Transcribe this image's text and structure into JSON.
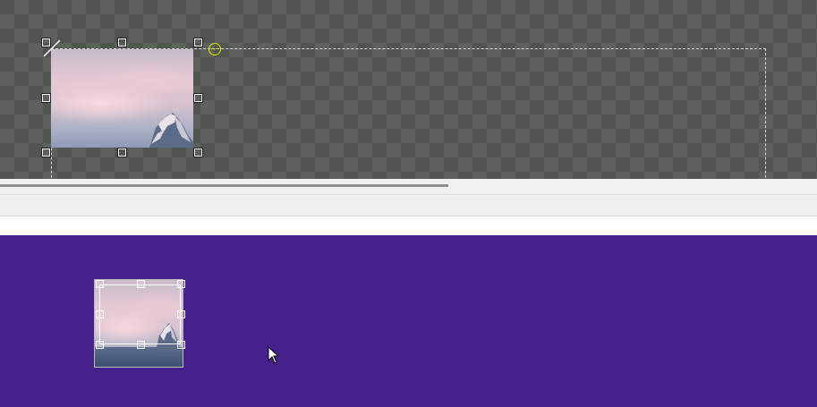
{
  "canvas": {
    "background": "#505550",
    "checker_color": "#5d625d",
    "bounds_border": "#d8dcd8",
    "selected_image": "mountain-photo",
    "rotation_handle_color": "#e6e600"
  },
  "preview": {
    "background": "#46218b",
    "thumbnail": "mountain-photo"
  },
  "cursor": "arrow-cursor-icon"
}
